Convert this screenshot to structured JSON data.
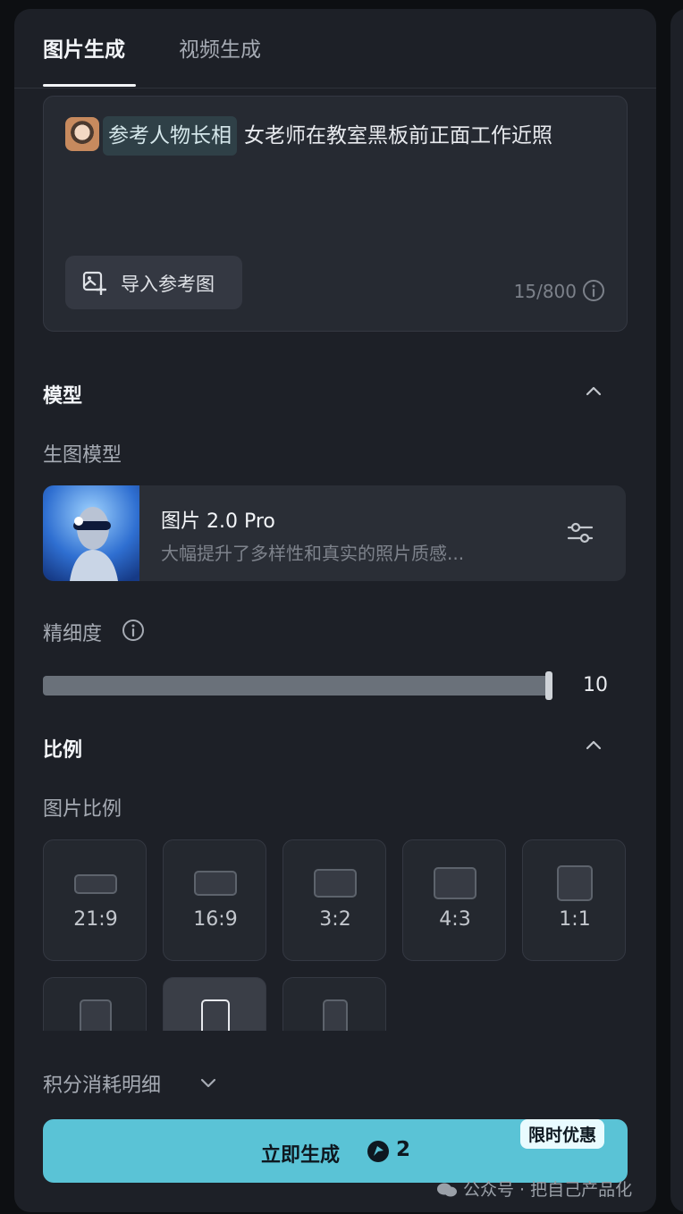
{
  "tabs": [
    {
      "label": "图片生成",
      "active": true
    },
    {
      "label": "视频生成",
      "active": false
    }
  ],
  "prompt": {
    "reference_tag": "参考人物长相",
    "text": "女老师在教室黑板前正面工作近照",
    "import_button": "导入参考图",
    "counter": "15/800"
  },
  "model_section": {
    "title": "模型",
    "sub_label": "生图模型",
    "model_name": "图片 2.0 Pro",
    "model_desc": "大幅提升了多样性和真实的照片质感..."
  },
  "detail": {
    "label": "精细度",
    "value": "10",
    "fraction": 1.0
  },
  "ratio_section": {
    "title": "比例",
    "sub_label": "图片比例",
    "ratios": [
      "21:9",
      "16:9",
      "3:2",
      "4:3",
      "1:1"
    ]
  },
  "credit_detail": "积分消耗明细",
  "generate": {
    "label": "立即生成",
    "cost": "2",
    "badge": "限时优惠"
  },
  "watermark": "公众号 · 把自己产品化",
  "colors": {
    "accent": "#5ac3d6",
    "panel_bg": "#1d2027"
  }
}
